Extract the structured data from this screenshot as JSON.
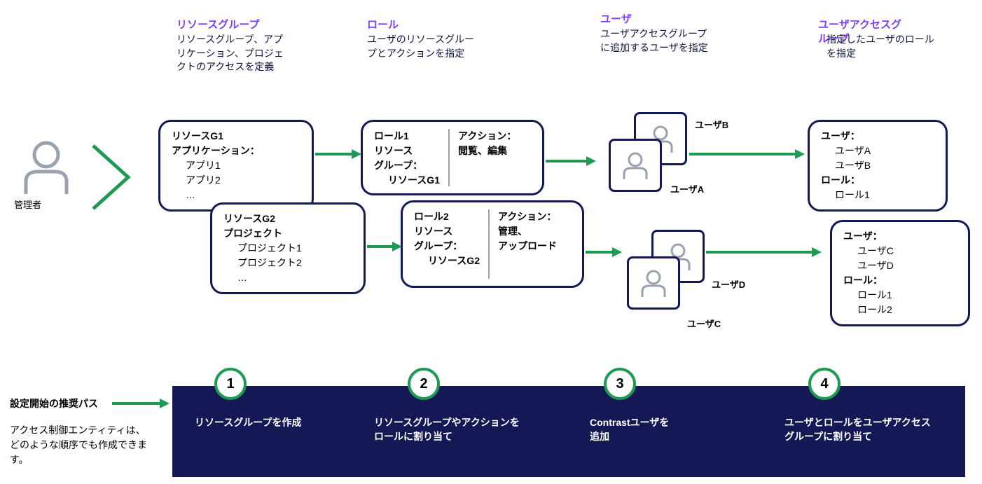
{
  "admin": {
    "label": "管理者"
  },
  "headers": {
    "resourceGroup": {
      "title": "リソースグループ",
      "desc": "リソースグループ、アプリケーション、プロジェクトのアクセスを定義"
    },
    "role": {
      "title": "ロール",
      "desc": "ユーザのリソースグループとアクションを指定"
    },
    "user": {
      "title": "ユーザ",
      "desc": "ユーザアクセスグループに追加するユーザを指定"
    },
    "uag": {
      "title1": "ユーザアクセスグ",
      "title2": "ループ",
      "desc": "指定したユーザのロールを指定"
    }
  },
  "rg1": {
    "name": "リソースG1",
    "label": "アプリケーション：",
    "items": [
      "アプリ1",
      "アプリ2",
      "…"
    ]
  },
  "rg2": {
    "name": "リソースG2",
    "label": "プロジェクト",
    "items": [
      "プロジェクト1",
      "プロジェクト2",
      "…"
    ]
  },
  "role1": {
    "name": "ロール1",
    "rgLabel": "リソース\nグループ：",
    "rgValue": "リソースG1",
    "actionLabel": "アクション：",
    "actions": "閲覧、編集"
  },
  "role2": {
    "name": "ロール2",
    "rgLabel": "リソース\nグループ：",
    "rgValue": "リソースG2",
    "actionLabel": "アクション：",
    "actions": "管理、\nアップロード"
  },
  "users": {
    "a": "ユーザA",
    "b": "ユーザB",
    "c": "ユーザC",
    "d": "ユーザD"
  },
  "uag1": {
    "userLabel": "ユーザ：",
    "users": [
      "ユーザA",
      "ユーザB"
    ],
    "roleLabel": "ロール：",
    "roles": [
      "ロール1"
    ]
  },
  "uag2": {
    "userLabel": "ユーザ：",
    "users": [
      "ユーザC",
      "ユーザD"
    ],
    "roleLabel": "ロール：",
    "roles": [
      "ロール1",
      "ロール2"
    ]
  },
  "bottom": {
    "left": {
      "title": "設定開始の推奨パス",
      "desc": "アクセス制御エンティティは、どのような順序でも作成できます。"
    },
    "steps": [
      {
        "num": "1",
        "text": "リソースグループを作成"
      },
      {
        "num": "2",
        "text": "リソースグループやアクションをロールに割り当て"
      },
      {
        "num": "3",
        "text": "Contrastユーザを\n追加"
      },
      {
        "num": "4",
        "text": "ユーザとロールをユーザアクセスグループに割り当て"
      }
    ]
  }
}
